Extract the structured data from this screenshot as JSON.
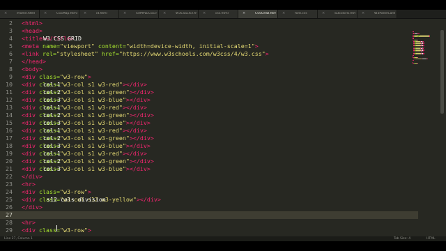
{
  "tabs": [
    {
      "label": "iframe.html",
      "active": false
    },
    {
      "label": "CSSMap.html",
      "active": false
    },
    {
      "label": "id.html",
      "active": false
    },
    {
      "label": "SAMPLECSS.HTML",
      "active": false
    },
    {
      "label": "W3CSSLIST.html",
      "active": false
    },
    {
      "label": "css.html",
      "active": false
    },
    {
      "label": "CSSGRID.html",
      "active": true
    },
    {
      "label": "font.css",
      "active": false
    },
    {
      "label": "w3colorsi.html",
      "active": false
    },
    {
      "label": "W3PanelCard.html",
      "active": false
    }
  ],
  "code_lines": [
    {
      "n": "2",
      "current": false,
      "segs": [
        {
          "c": "tag",
          "t": "<html>"
        }
      ]
    },
    {
      "n": "3",
      "current": false,
      "segs": [
        {
          "c": "tag",
          "t": "<head>"
        }
      ]
    },
    {
      "n": "4",
      "current": false,
      "segs": [
        {
          "c": "txt",
          "t": "    "
        },
        {
          "c": "tag",
          "t": "<title>"
        },
        {
          "c": "txt",
          "t": "W3.CSS GRID"
        },
        {
          "c": "tag",
          "t": "</title>"
        }
      ]
    },
    {
      "n": "5",
      "current": false,
      "segs": [
        {
          "c": "tag",
          "t": "<meta "
        },
        {
          "c": "attr",
          "t": "name="
        },
        {
          "c": "str",
          "t": "\"viewport\""
        },
        {
          "c": "attr",
          "t": " content="
        },
        {
          "c": "str",
          "t": "\"width=device-width, initial-scale=1\""
        },
        {
          "c": "tag",
          "t": ">"
        }
      ]
    },
    {
      "n": "6",
      "current": false,
      "segs": [
        {
          "c": "tag",
          "t": "<link "
        },
        {
          "c": "attr",
          "t": "rel="
        },
        {
          "c": "str",
          "t": "\"stylesheet\""
        },
        {
          "c": "attr",
          "t": " href="
        },
        {
          "c": "str",
          "t": "\"https://www.w3schools.com/w3css/4/w3.css\""
        },
        {
          "c": "tag",
          "t": ">"
        }
      ]
    },
    {
      "n": "7",
      "current": false,
      "segs": [
        {
          "c": "tag",
          "t": "</head>"
        }
      ]
    },
    {
      "n": "8",
      "current": false,
      "segs": [
        {
          "c": "tag",
          "t": "<body>"
        }
      ]
    },
    {
      "n": "9",
      "current": false,
      "segs": [
        {
          "c": "tag",
          "t": "<div "
        },
        {
          "c": "attr",
          "t": "class="
        },
        {
          "c": "str",
          "t": "\"w3-row\""
        },
        {
          "c": "tag",
          "t": ">"
        }
      ]
    },
    {
      "n": "10",
      "current": false,
      "segs": [
        {
          "c": "txt",
          "t": "    "
        },
        {
          "c": "tag",
          "t": "<div "
        },
        {
          "c": "attr",
          "t": "class="
        },
        {
          "c": "str",
          "t": "\"w3-col s1 w3-red\""
        },
        {
          "c": "tag",
          "t": ">"
        },
        {
          "c": "txt",
          "t": "col-1"
        },
        {
          "c": "tag",
          "t": "</div>"
        }
      ]
    },
    {
      "n": "11",
      "current": false,
      "segs": [
        {
          "c": "txt",
          "t": "    "
        },
        {
          "c": "tag",
          "t": "<div "
        },
        {
          "c": "attr",
          "t": "class="
        },
        {
          "c": "str",
          "t": "\"w3-col s1 w3-green\""
        },
        {
          "c": "tag",
          "t": ">"
        },
        {
          "c": "txt",
          "t": "col-2"
        },
        {
          "c": "tag",
          "t": "</div>"
        }
      ]
    },
    {
      "n": "12",
      "current": false,
      "segs": [
        {
          "c": "txt",
          "t": "    "
        },
        {
          "c": "tag",
          "t": "<div "
        },
        {
          "c": "attr",
          "t": "class="
        },
        {
          "c": "str",
          "t": "\"w3-col s1 w3-blue\""
        },
        {
          "c": "tag",
          "t": ">"
        },
        {
          "c": "txt",
          "t": "col-3"
        },
        {
          "c": "tag",
          "t": "</div>"
        }
      ]
    },
    {
      "n": "13",
      "current": false,
      "segs": [
        {
          "c": "txt",
          "t": "    "
        },
        {
          "c": "tag",
          "t": "<div "
        },
        {
          "c": "attr",
          "t": "class="
        },
        {
          "c": "str",
          "t": "\"w3-col s1 w3-red\""
        },
        {
          "c": "tag",
          "t": ">"
        },
        {
          "c": "txt",
          "t": "col-1"
        },
        {
          "c": "tag",
          "t": "</div>"
        }
      ]
    },
    {
      "n": "14",
      "current": false,
      "segs": [
        {
          "c": "txt",
          "t": "    "
        },
        {
          "c": "tag",
          "t": "<div "
        },
        {
          "c": "attr",
          "t": "class="
        },
        {
          "c": "str",
          "t": "\"w3-col s1 w3-green\""
        },
        {
          "c": "tag",
          "t": ">"
        },
        {
          "c": "txt",
          "t": "col-2"
        },
        {
          "c": "tag",
          "t": "</div>"
        }
      ]
    },
    {
      "n": "15",
      "current": false,
      "segs": [
        {
          "c": "txt",
          "t": "    "
        },
        {
          "c": "tag",
          "t": "<div "
        },
        {
          "c": "attr",
          "t": "class="
        },
        {
          "c": "str",
          "t": "\"w3-col s1 w3-blue\""
        },
        {
          "c": "tag",
          "t": ">"
        },
        {
          "c": "txt",
          "t": "col-3"
        },
        {
          "c": "tag",
          "t": "</div>"
        }
      ]
    },
    {
      "n": "16",
      "current": false,
      "segs": [
        {
          "c": "txt",
          "t": "    "
        },
        {
          "c": "tag",
          "t": "<div "
        },
        {
          "c": "attr",
          "t": "class="
        },
        {
          "c": "str",
          "t": "\"w3-col s1 w3-red\""
        },
        {
          "c": "tag",
          "t": ">"
        },
        {
          "c": "txt",
          "t": "col-1"
        },
        {
          "c": "tag",
          "t": "</div>"
        }
      ]
    },
    {
      "n": "17",
      "current": false,
      "segs": [
        {
          "c": "txt",
          "t": "    "
        },
        {
          "c": "tag",
          "t": "<div "
        },
        {
          "c": "attr",
          "t": "class="
        },
        {
          "c": "str",
          "t": "\"w3-col s1 w3-green\""
        },
        {
          "c": "tag",
          "t": ">"
        },
        {
          "c": "txt",
          "t": "col-2"
        },
        {
          "c": "tag",
          "t": "</div>"
        }
      ]
    },
    {
      "n": "18",
      "current": false,
      "segs": [
        {
          "c": "txt",
          "t": "    "
        },
        {
          "c": "tag",
          "t": "<div "
        },
        {
          "c": "attr",
          "t": "class="
        },
        {
          "c": "str",
          "t": "\"w3-col s1 w3-blue\""
        },
        {
          "c": "tag",
          "t": ">"
        },
        {
          "c": "txt",
          "t": "col-3"
        },
        {
          "c": "tag",
          "t": "</div>"
        }
      ]
    },
    {
      "n": "19",
      "current": false,
      "segs": [
        {
          "c": "txt",
          "t": "    "
        },
        {
          "c": "tag",
          "t": "<div "
        },
        {
          "c": "attr",
          "t": "class="
        },
        {
          "c": "str",
          "t": "\"w3-col s1 w3-red\""
        },
        {
          "c": "tag",
          "t": ">"
        },
        {
          "c": "txt",
          "t": "col-1"
        },
        {
          "c": "tag",
          "t": "</div>"
        }
      ]
    },
    {
      "n": "20",
      "current": false,
      "segs": [
        {
          "c": "txt",
          "t": "    "
        },
        {
          "c": "tag",
          "t": "<div "
        },
        {
          "c": "attr",
          "t": "class="
        },
        {
          "c": "str",
          "t": "\"w3-col s1 w3-green\""
        },
        {
          "c": "tag",
          "t": ">"
        },
        {
          "c": "txt",
          "t": "col-2"
        },
        {
          "c": "tag",
          "t": "</div>"
        }
      ]
    },
    {
      "n": "21",
      "current": false,
      "segs": [
        {
          "c": "txt",
          "t": "    "
        },
        {
          "c": "tag",
          "t": "<div "
        },
        {
          "c": "attr",
          "t": "class="
        },
        {
          "c": "str",
          "t": "\"w3-col s1 w3-blue\""
        },
        {
          "c": "tag",
          "t": ">"
        },
        {
          "c": "txt",
          "t": "col-3"
        },
        {
          "c": "tag",
          "t": "</div>"
        }
      ]
    },
    {
      "n": "22",
      "current": false,
      "segs": [
        {
          "c": "tag",
          "t": "</div>"
        }
      ]
    },
    {
      "n": "23",
      "current": false,
      "segs": [
        {
          "c": "tag",
          "t": "<hr>"
        }
      ]
    },
    {
      "n": "24",
      "current": false,
      "segs": [
        {
          "c": "tag",
          "t": "<div "
        },
        {
          "c": "attr",
          "t": "class="
        },
        {
          "c": "str",
          "t": "\"w3-row\""
        },
        {
          "c": "tag",
          "t": ">"
        }
      ]
    },
    {
      "n": "25",
      "current": false,
      "segs": [
        {
          "c": "txt",
          "t": "    "
        },
        {
          "c": "tag",
          "t": "<div "
        },
        {
          "c": "attr",
          "t": "class="
        },
        {
          "c": "str",
          "t": "\"w3-col s12 w3-yellow\""
        },
        {
          "c": "tag",
          "t": ">"
        },
        {
          "c": "txt",
          "t": " s12 cols division"
        },
        {
          "c": "tag",
          "t": "</div>"
        }
      ]
    },
    {
      "n": "26",
      "current": false,
      "segs": [
        {
          "c": "tag",
          "t": "</div>"
        }
      ]
    },
    {
      "n": "27",
      "current": true,
      "segs": []
    },
    {
      "n": "28",
      "current": false,
      "segs": [
        {
          "c": "tag",
          "t": "<hr>"
        }
      ]
    },
    {
      "n": "29",
      "current": false,
      "segs": [
        {
          "c": "tag",
          "t": "<div "
        },
        {
          "c": "attr",
          "t": "class="
        },
        {
          "c": "str",
          "t": "\"w3-row\""
        },
        {
          "c": "tag",
          "t": ">"
        }
      ]
    }
  ],
  "status": {
    "position": "Line 27, Column 1",
    "tab_size": "Tab Size: 4",
    "syntax": "HTML"
  },
  "colors": {
    "background": "#272822",
    "tag": "#f92672",
    "attribute": "#a6e22e",
    "string": "#e6db74",
    "text": "#f8f8f2",
    "current_line": "#3e3d32"
  }
}
